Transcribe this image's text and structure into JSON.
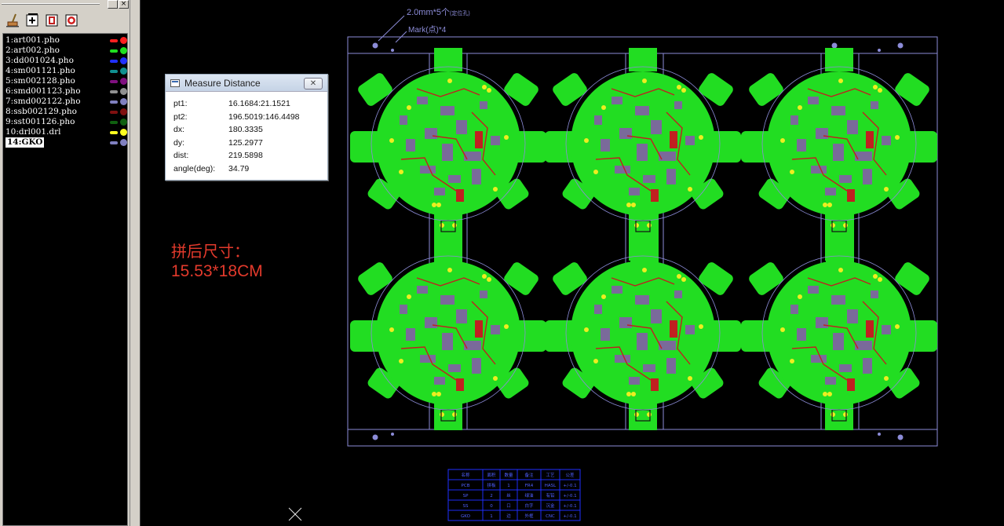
{
  "window_controls": {
    "close_glyph": "×"
  },
  "toolbar": {
    "icons": [
      "broom-icon",
      "add-layer-icon",
      "layer-copy-icon",
      "layer-delete-icon"
    ]
  },
  "layers": [
    {
      "label": "1:art001.pho",
      "color": "#ff2020"
    },
    {
      "label": "2:art002.pho",
      "color": "#20e020"
    },
    {
      "label": "3:dd001024.pho",
      "color": "#2030ff"
    },
    {
      "label": "4:sm001121.pho",
      "color": "#109090"
    },
    {
      "label": "5:sm002128.pho",
      "color": "#801080"
    },
    {
      "label": "6:smd001123.pho",
      "color": "#909090"
    },
    {
      "label": "7:smd002122.pho",
      "color": "#8080c0"
    },
    {
      "label": "8:ssb002129.pho",
      "color": "#801010"
    },
    {
      "label": "9:sst001126.pho",
      "color": "#106010"
    },
    {
      "label": "10:drl001.drl",
      "color": "#ffff20"
    },
    {
      "label": "14:GKO",
      "color": "#8080c0",
      "selected": true
    }
  ],
  "measure_window": {
    "title": "Measure Distance",
    "close_glyph": "✕",
    "rows": [
      {
        "key": "pt1:",
        "value": "16.1684:21.1521"
      },
      {
        "key": "pt2:",
        "value": "196.5019:146.4498"
      },
      {
        "key": "dx:",
        "value": "180.3335"
      },
      {
        "key": "dy:",
        "value": "125.2977"
      },
      {
        "key": "dist:",
        "value": "219.5898"
      },
      {
        "key": "angle(deg):",
        "value": "34.79"
      }
    ]
  },
  "annotation": {
    "title": "拼后尺寸：",
    "size": "15.53*18CM"
  },
  "pcb": {
    "note_holes": "2.0mm*5个",
    "note_holes_sub": "(定位孔)",
    "note_mark": "Mark(点)*4",
    "board_color": "#22dd22",
    "outline_color": "#8c8cd8",
    "panel_cols": 3,
    "panel_rows": 2
  },
  "table": {
    "header": [
      "名称",
      "面积",
      "数量",
      "备注",
      "工艺",
      "公差"
    ],
    "rows": [
      [
        "PCB",
        "拼板",
        "1",
        "FR4",
        "HASL",
        "+/-0.1"
      ],
      [
        "SP",
        "2",
        "丝",
        "绿油",
        "有铅",
        "+/-0.1"
      ],
      [
        "SS",
        "0",
        "口",
        "白字",
        "沉金",
        "+/-0.1"
      ],
      [
        "GKO",
        "1",
        "边",
        "外框",
        "CNC",
        "+/-0.1"
      ]
    ]
  }
}
